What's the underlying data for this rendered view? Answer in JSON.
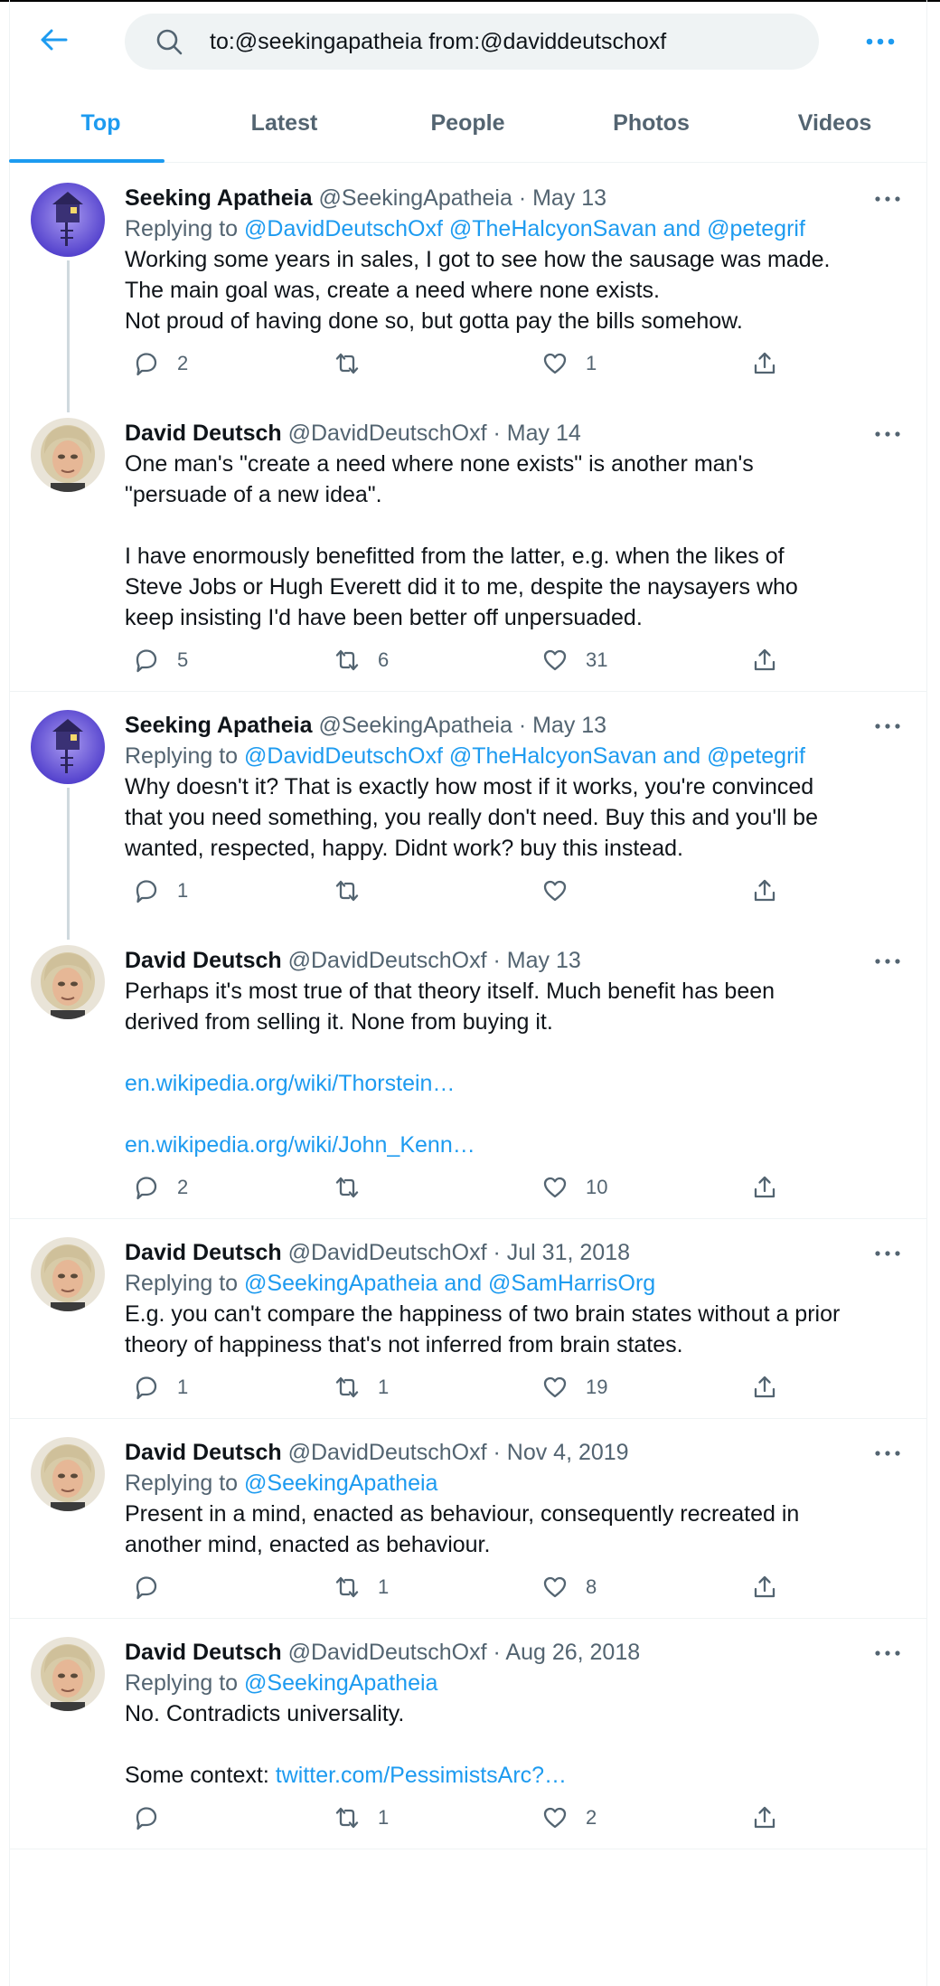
{
  "search": {
    "query": "to:@seekingapatheia from:@daviddeutschoxf"
  },
  "tabs": [
    "Top",
    "Latest",
    "People",
    "Photos",
    "Videos"
  ],
  "threads": [
    {
      "tweets": [
        {
          "name": "Seeking Apatheia",
          "handle": "@SeekingApatheia",
          "date": "May 13",
          "replying_label": "Replying to",
          "replying_to": "@DavidDeutschOxf @TheHalcyonSavan and @petegrif",
          "lines": [
            "Working some years in sales, I got to see how the sausage was made.",
            "The main goal was, create a need where none exists.",
            "Not proud of having done so, but gotta pay the bills somehow."
          ],
          "replies": "2",
          "retweets": "",
          "likes": "1"
        },
        {
          "name": "David Deutsch",
          "handle": "@DavidDeutschOxf",
          "date": "May 14",
          "lines": [
            "One man's \"create a need where none exists\" is another man's",
            "\"persuade of a new idea\".",
            "",
            "I have enormously benefitted from the latter, e.g. when the likes of",
            "Steve Jobs or Hugh Everett did it to me, despite the naysayers who",
            "keep insisting I'd have been better off unpersuaded."
          ],
          "replies": "5",
          "retweets": "6",
          "likes": "31"
        }
      ]
    },
    {
      "tweets": [
        {
          "name": "Seeking Apatheia",
          "handle": "@SeekingApatheia",
          "date": "May 13",
          "replying_label": "Replying to",
          "replying_to": "@DavidDeutschOxf @TheHalcyonSavan and @petegrif",
          "lines": [
            "Why doesn't it? That is exactly how most if it works, you're convinced",
            "that you need something, you really don't need. Buy this and you'll be",
            "wanted, respected, happy. Didnt work? buy this instead."
          ],
          "replies": "1",
          "retweets": "",
          "likes": ""
        },
        {
          "name": "David Deutsch",
          "handle": "@DavidDeutschOxf",
          "date": "May 13",
          "lines": [
            "Perhaps it's most true of that theory itself. Much benefit has been",
            "derived from selling it. None from buying it."
          ],
          "links": [
            "en.wikipedia.org/wiki/Thorstein…",
            "en.wikipedia.org/wiki/John_Kenn…"
          ],
          "replies": "2",
          "retweets": "",
          "likes": "10"
        }
      ]
    },
    {
      "tweets": [
        {
          "name": "David Deutsch",
          "handle": "@DavidDeutschOxf",
          "date": "Jul 31, 2018",
          "replying_label": "Replying to",
          "replying_to": "@SeekingApatheia and @SamHarrisOrg",
          "lines": [
            "E.g. you can't compare the happiness of two brain states without a prior",
            "theory of happiness that's not inferred from brain states."
          ],
          "replies": "1",
          "retweets": "1",
          "likes": "19"
        }
      ]
    },
    {
      "tweets": [
        {
          "name": "David Deutsch",
          "handle": "@DavidDeutschOxf",
          "date": "Nov 4, 2019",
          "replying_label": "Replying to",
          "replying_to": "@SeekingApatheia",
          "lines": [
            "Present in a mind, enacted as behaviour, consequently recreated in",
            "another mind, enacted as behaviour."
          ],
          "replies": "",
          "retweets": "1",
          "likes": "8"
        }
      ]
    },
    {
      "tweets": [
        {
          "name": "David Deutsch",
          "handle": "@DavidDeutschOxf",
          "date": "Aug 26, 2018",
          "replying_label": "Replying to",
          "replying_to": "@SeekingApatheia",
          "lines": [
            "No. Contradicts universality."
          ],
          "context_label": "Some context:",
          "context_link": "twitter.com/PessimistsArc?…",
          "replies": "",
          "retweets": "1",
          "likes": "2"
        }
      ]
    }
  ],
  "separator": "·",
  "icons": {
    "back": "arrow-left-icon",
    "search": "search-icon",
    "more": "more-horizontal-icon",
    "reply": "reply-icon",
    "retweet": "retweet-icon",
    "like": "heart-icon",
    "share": "share-icon"
  },
  "colors": {
    "accent": "#1d9bf0",
    "text": "#0f1419",
    "muted": "#536471",
    "search_bg": "#eff3f4"
  }
}
